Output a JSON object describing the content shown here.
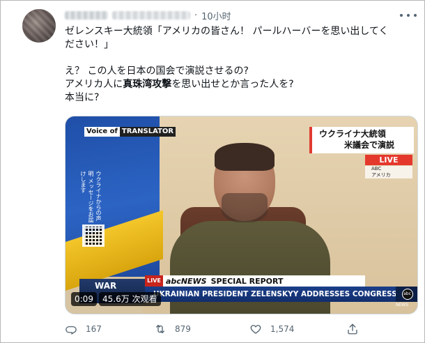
{
  "tweet": {
    "time": "10小时",
    "text_lines": [
      "ゼレンスキー大統領「アメリカの皆さん！ パールハーバーを思い出してく",
      "ださい！」"
    ],
    "question_lines": [
      "え？ この人を日本の国会で演説させるの?"
    ],
    "line3_pre": "アメリカ人に",
    "line3_bold": "真珠湾攻撃",
    "line3_post": "を思い出せとか言った人を?",
    "line4": "本当に?"
  },
  "video": {
    "voice_of": "Voice of",
    "translator": "TRANSLATOR",
    "headline_line1": "ウクライナ大統領",
    "headline_line2": "米議会で演説",
    "live_badge": "LIVE",
    "abc_small_1": "ABC",
    "abc_small_2": "アメリカ",
    "vertical_text": "ウクライナからの声明 メッセージをお届けします",
    "lower_live": "LIVE",
    "lower_war": "WAR",
    "lower_abc": "abcNEWS",
    "lower_special": "SPECIAL REPORT",
    "lower_headline": "UKRAINIAN PRESIDENT ZELENSKYY ADDRESSES CONGRESS",
    "lower_logo": "abc",
    "lower_news": "NEWS",
    "timestamp": "0:09",
    "views": "45.6万 次观看"
  },
  "actions": {
    "reply_count": "167",
    "retweet_count": "879",
    "like_count": "1,574"
  },
  "icons": {
    "reply": "reply-icon",
    "retweet": "retweet-icon",
    "like": "like-icon",
    "share": "share-icon",
    "more": "more-icon"
  }
}
